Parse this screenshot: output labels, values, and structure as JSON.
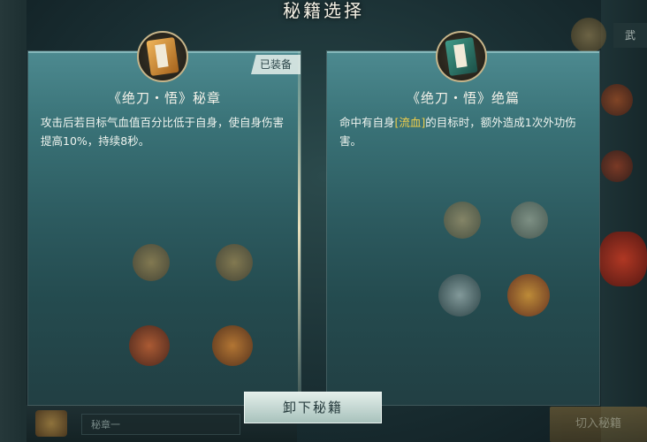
{
  "screen": {
    "title": "秘籍选择"
  },
  "cards": [
    {
      "name": "《绝刀・悟》秘章",
      "badge": "已装备",
      "desc": "攻击后若目标气血值百分比低于自身，使自身伤害提高10%，持续8秒。",
      "icon": "gold-book-icon"
    },
    {
      "name": "《绝刀・悟》绝篇",
      "desc_before": "命中有自身",
      "desc_highlight": "[流血]",
      "desc_after": "的目标时，额外造成1次外功伤害。",
      "icon": "teal-book-icon"
    }
  ],
  "actions": {
    "unequip_label": "卸下秘籍"
  },
  "background": {
    "top_tab": "武",
    "select_value": "秘章一",
    "gold_button": "切入秘籍"
  },
  "colors": {
    "highlight": "#f2cf4a",
    "card_top": "#4d8a90",
    "card_bottom": "#223f43"
  }
}
